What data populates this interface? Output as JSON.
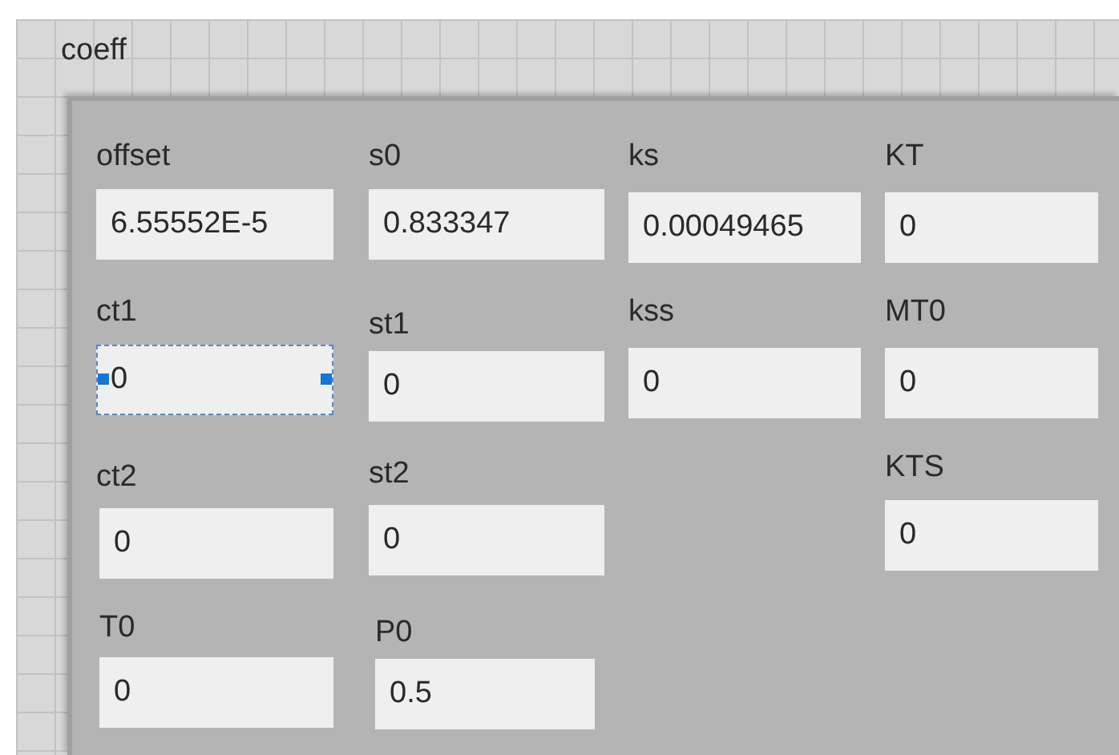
{
  "cluster": {
    "label": "coeff",
    "controls": [
      {
        "label": "offset",
        "value": "6.55552E-5",
        "selected": false
      },
      {
        "label": "s0",
        "value": "0.833347",
        "selected": false
      },
      {
        "label": "ks",
        "value": "0.00049465",
        "selected": false
      },
      {
        "label": "KT",
        "value": "0",
        "selected": false
      },
      {
        "label": "ct1",
        "value": "0",
        "selected": true
      },
      {
        "label": "st1",
        "value": "0",
        "selected": false
      },
      {
        "label": "kss",
        "value": "0",
        "selected": false
      },
      {
        "label": "MT0",
        "value": "0",
        "selected": false
      },
      {
        "label": "ct2",
        "value": "0",
        "selected": false
      },
      {
        "label": "st2",
        "value": "0",
        "selected": false
      },
      {
        "label": "KTS",
        "value": "0",
        "selected": false
      },
      {
        "label": "T0",
        "value": "0",
        "selected": false
      },
      {
        "label": "P0",
        "value": "0.5",
        "selected": false
      }
    ]
  }
}
